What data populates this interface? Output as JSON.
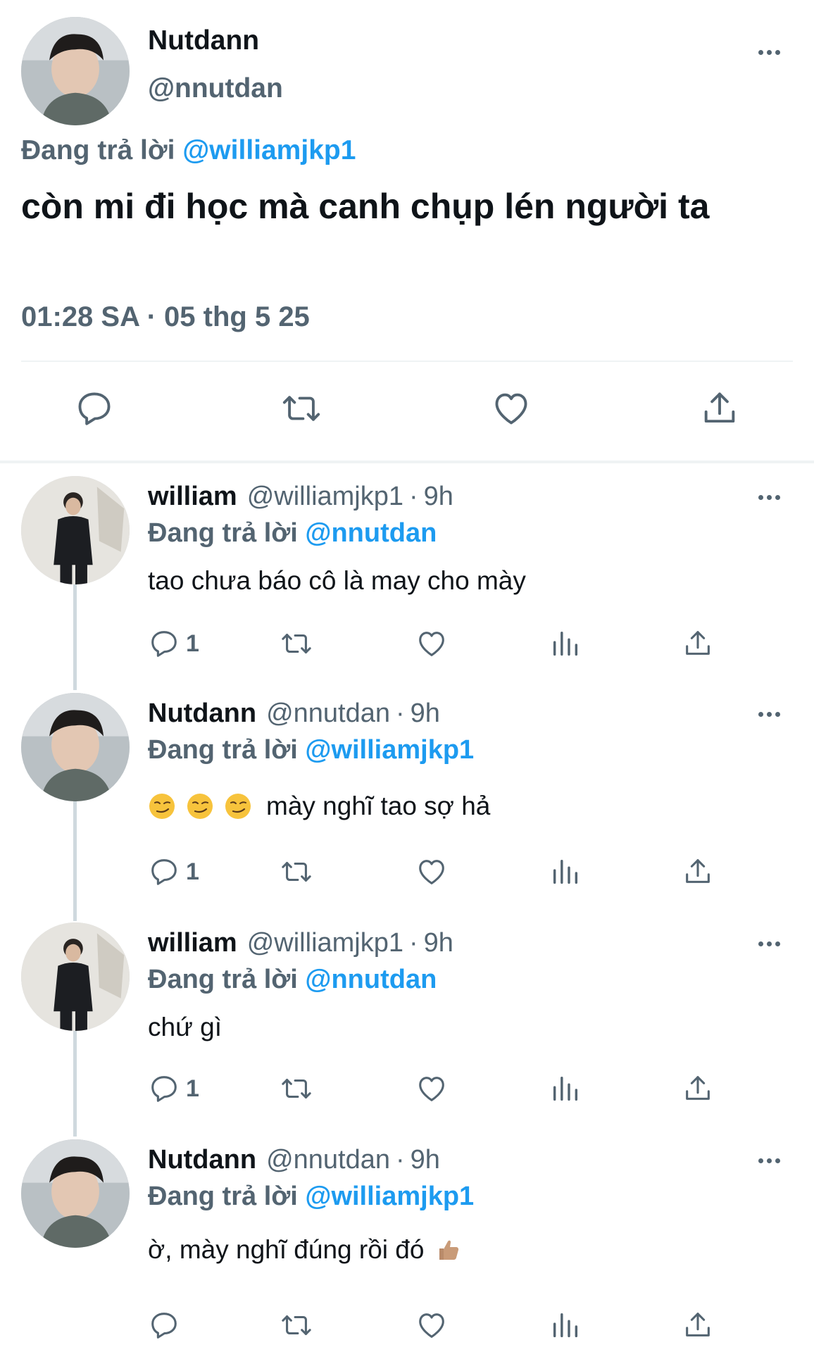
{
  "main_tweet": {
    "display_name": "Nutdann",
    "handle": "@nnutdan",
    "replying_prefix": "Đang trả lời",
    "replying_to": "@williamjkp1",
    "text": "còn mi đi học mà canh chụp lén người ta",
    "timestamp": "01:28 SA · 05 thg 5 25",
    "actions": [
      "reply-icon",
      "retweet-icon",
      "like-icon",
      "share-icon"
    ]
  },
  "replies": [
    {
      "display_name": "william",
      "handle": "@williamjkp1",
      "separator": "·",
      "time": "9h",
      "replying_prefix": "Đang trả lời",
      "replying_to": "@nnutdan",
      "text": "tao chưa báo cô là may cho mày",
      "reply_count": "1"
    },
    {
      "display_name": "Nutdann",
      "handle": "@nnutdan",
      "separator": "·",
      "time": "9h",
      "replying_prefix": "Đang trả lời",
      "replying_to": "@williamjkp1",
      "text": "mày nghĩ tao sợ hả",
      "emojis": [
        "smirking-face",
        "smirking-face",
        "smirking-face"
      ],
      "reply_count": "1"
    },
    {
      "display_name": "william",
      "handle": "@williamjkp1",
      "separator": "·",
      "time": "9h",
      "replying_prefix": "Đang trả lời",
      "replying_to": "@nnutdan",
      "text": "chứ gì",
      "reply_count": "1"
    },
    {
      "display_name": "Nutdann",
      "handle": "@nnutdan",
      "separator": "·",
      "time": "9h",
      "replying_prefix": "Đang trả lời",
      "replying_to": "@williamjkp1",
      "text": "ờ, mày nghĩ đúng rồi đó",
      "emojis_after": [
        "thumbs-up"
      ],
      "reply_count": ""
    }
  ],
  "colors": {
    "text": "#0f1419",
    "secondary": "#536471",
    "accent": "#1d9bf0",
    "divider": "#eff3f4",
    "thread_line": "#cfd9de"
  }
}
